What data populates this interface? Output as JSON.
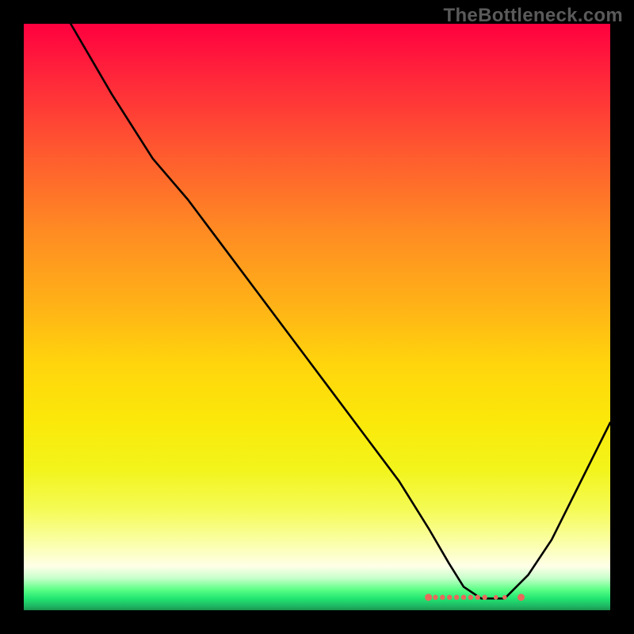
{
  "watermark": {
    "text": "TheBottleneck.com"
  },
  "chart_data": {
    "type": "line",
    "title": "",
    "xlabel": "",
    "ylabel": "",
    "xlim": [
      0,
      100
    ],
    "ylim": [
      0,
      100
    ],
    "grid": false,
    "legend": false,
    "background_gradient": {
      "direction": "vertical",
      "stops": [
        {
          "pos": 0,
          "color": "#ff003f"
        },
        {
          "pos": 50,
          "color": "#ffc510"
        },
        {
          "pos": 80,
          "color": "#f2f41b"
        },
        {
          "pos": 93,
          "color": "#ffffe8"
        },
        {
          "pos": 96,
          "color": "#5bff86"
        },
        {
          "pos": 100,
          "color": "#1a944f"
        }
      ]
    },
    "series": [
      {
        "name": "curve",
        "x": [
          8,
          15,
          22,
          28,
          34,
          40,
          46,
          52,
          58,
          64,
          69,
          72.5,
          75,
          78,
          82,
          86,
          90,
          94,
          98,
          100
        ],
        "values": [
          100,
          88,
          77,
          70,
          62,
          54,
          46,
          38,
          30,
          22,
          14,
          8,
          4,
          2,
          2,
          6,
          12,
          20,
          28,
          32
        ]
      }
    ],
    "markers": {
      "name": "highlight-band",
      "color": "#e86a5b",
      "points": [
        {
          "x": 69.0,
          "y": 2.2,
          "r": 4.5
        },
        {
          "x": 70.2,
          "y": 2.2,
          "r": 3.2
        },
        {
          "x": 71.4,
          "y": 2.2,
          "r": 3.2
        },
        {
          "x": 72.6,
          "y": 2.2,
          "r": 3.2
        },
        {
          "x": 73.8,
          "y": 2.2,
          "r": 3.2
        },
        {
          "x": 75.0,
          "y": 2.2,
          "r": 3.2
        },
        {
          "x": 76.2,
          "y": 2.2,
          "r": 3.2
        },
        {
          "x": 77.4,
          "y": 2.2,
          "r": 3.2
        },
        {
          "x": 78.6,
          "y": 2.2,
          "r": 3.2
        },
        {
          "x": 80.5,
          "y": 2.2,
          "r": 2.8
        },
        {
          "x": 82.0,
          "y": 2.2,
          "r": 2.8
        },
        {
          "x": 84.8,
          "y": 2.2,
          "r": 4.5
        }
      ]
    }
  }
}
